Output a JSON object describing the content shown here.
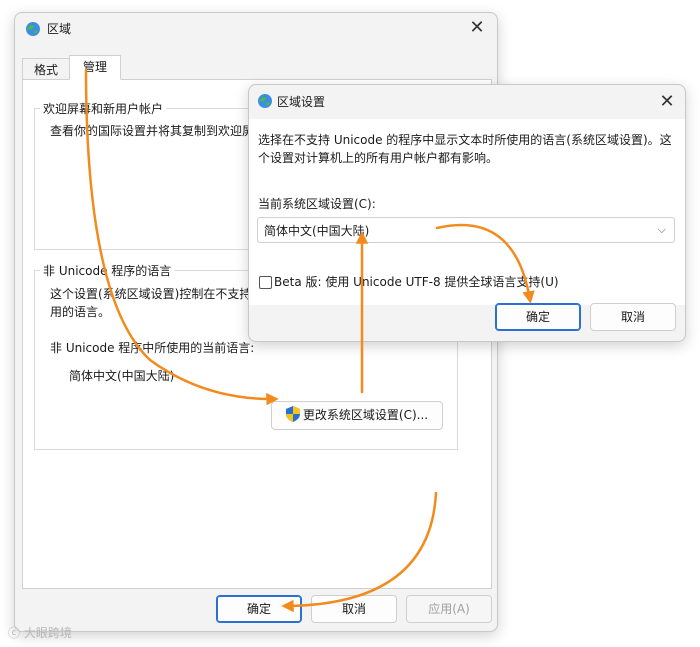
{
  "region_window": {
    "title": "区域",
    "close_glyph": "✕",
    "tabs": [
      {
        "label": "格式",
        "active": false
      },
      {
        "label": "管理",
        "active": true
      }
    ],
    "welcome_group": {
      "legend": "欢迎屏幕和新用户帐户",
      "desc": "查看你的国际设置并将其复制到欢迎屏"
    },
    "nonunicode_group": {
      "legend": "非 Unicode 程序的语言",
      "desc_line1": "这个设置(系统区域设置)控制在不支持",
      "desc_line2": "用的语言。",
      "current_label": "非 Unicode 程序中所使用的当前语言:",
      "current_value": "简体中文(中国大陆)",
      "change_button": "更改系统区域设置(C)..."
    },
    "footer": {
      "ok": "确定",
      "cancel": "取消",
      "apply": "应用(A)"
    }
  },
  "locale_dialog": {
    "title": "区域设置",
    "close_glyph": "✕",
    "desc_line1": "选择在不支持 Unicode 的程序中显示文本时所使用的语言(系统区域设置)。这",
    "desc_line2": "个设置对计算机上的所有用户帐户都有影响。",
    "current_label": "当前系统区域设置(C):",
    "select_value": "简体中文(中国大陆)",
    "chevron_glyph": "⌵",
    "beta_label": "Beta 版: 使用 Unicode UTF-8 提供全球语言支持(U)",
    "beta_checked": false,
    "ok": "确定",
    "cancel": "取消"
  },
  "annotation_color": "#f28a1e",
  "watermark": "大眼跨境"
}
